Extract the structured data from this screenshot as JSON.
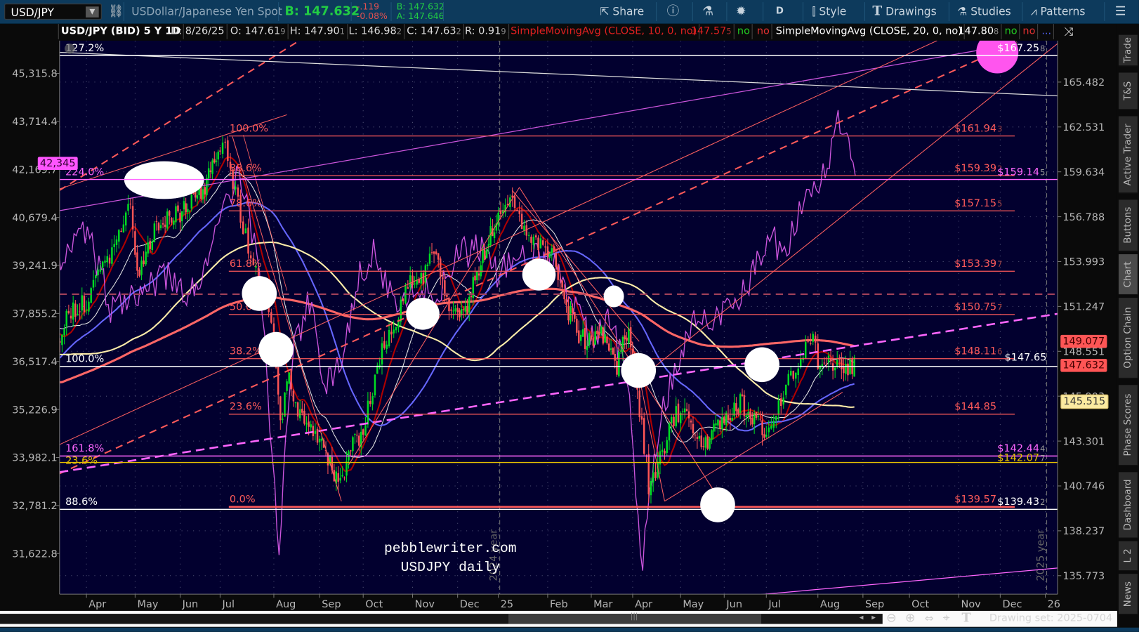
{
  "toolbar": {
    "symbol": "USD/JPY",
    "description": "USDollar/Japanese Yen Spot",
    "bid_big": "B: 147.632",
    "change": "-.119",
    "change_pct": "-0.08%",
    "bid": "B: 147.632",
    "ask": "A: 147.646",
    "share": "Share",
    "period": "D",
    "style": "Style",
    "drawings": "Drawings",
    "studies": "Studies",
    "patterns": "Patterns"
  },
  "header": {
    "title": "USD/JPY (BID) 5 Y 1D",
    "date": "D: 8/26/25",
    "open": "O: 147.61",
    "open_sub": "9",
    "high": "H: 147.90",
    "high_sub": "1",
    "low": "L: 146.98",
    "low_sub": "2",
    "close": "C: 147.63",
    "close_sub": "2",
    "range": "R: 0.91",
    "range_sub": "9",
    "sma10_label": "SimpleMovingAvg (CLOSE, 10, 0, no)",
    "sma10_value": "147.57",
    "sma10_sub": "5",
    "sma10_no1": "no",
    "sma10_no2": "no",
    "sma20_label": "SimpleMovingAvg (CLOSE, 20, 0, no)",
    "sma20_value": "147.80",
    "sma20_sub": "8",
    "sma20_no1": "no",
    "sma20_no2": "no",
    "more": "..."
  },
  "sidebar": [
    "Trade",
    "T&S",
    "Active Trader",
    "Buttons",
    "Chart",
    "Option Chain",
    "Phase Scores",
    "Dashboard",
    "L 2",
    "News"
  ],
  "sidebar_active": "Chart",
  "watermark": {
    "line1": "pebblewriter.com",
    "line2": "USDJPY daily"
  },
  "year_labels": [
    "2024 year",
    "2025 year"
  ],
  "bottom": {
    "drawing_set": "Drawing set: 2025-0704"
  },
  "badges": {
    "left_nikkei": "42,345",
    "sma200": "149.077",
    "last": "147.632",
    "sma100": "145.515"
  },
  "colors": {
    "bg": "#02002f",
    "up": "#00dd22",
    "down": "#ff5555",
    "fib": "#ff5a5a",
    "magenta": "#ff66ff",
    "yellow": "#ffe36e",
    "accent_green": "#22cc44"
  },
  "chart_data": {
    "type": "candlestick",
    "symbol": "USD/JPY",
    "right_axis_ticks": [
      "165.482",
      "162.531",
      "159.634",
      "156.788",
      "153.993",
      "151.247",
      "148.551",
      "145.903",
      "143.301",
      "140.746",
      "138.237",
      "135.773"
    ],
    "left_axis_ticks": [
      "45,315.8",
      "43,714.4",
      "42,169.7",
      "40,679.4",
      "39,241.9",
      "37,855.2",
      "36,517.4",
      "35,226.9",
      "33,982.1",
      "32,781.2",
      "31,622.8"
    ],
    "x_ticks": [
      "Apr",
      "May",
      "Jun",
      "Jul",
      "Aug",
      "Sep",
      "Oct",
      "Nov",
      "Dec",
      "25",
      "Feb",
      "Mar",
      "Apr",
      "May",
      "Jun",
      "Jul",
      "Aug",
      "Sep",
      "Oct",
      "Nov",
      "Dec",
      "26"
    ],
    "price_keypoints_months_since_apr2024": [
      [
        -10,
        140
      ],
      [
        -8,
        144
      ],
      [
        -6,
        149
      ],
      [
        -4.5,
        151.5
      ],
      [
        -3.5,
        147
      ],
      [
        -3,
        142
      ],
      [
        -2.5,
        146
      ],
      [
        -2,
        148
      ],
      [
        -1.5,
        150
      ],
      [
        -1,
        150.5
      ],
      [
        -0.6,
        148.5
      ],
      [
        -0.4,
        151
      ],
      [
        0,
        151.5
      ],
      [
        0.5,
        154.5
      ],
      [
        0.9,
        157.5
      ],
      [
        1.05,
        153
      ],
      [
        1.5,
        156.5
      ],
      [
        2,
        157
      ],
      [
        2.6,
        158.5
      ],
      [
        3.05,
        161.7
      ],
      [
        3.3,
        158
      ],
      [
        3.6,
        154
      ],
      [
        3.95,
        150
      ],
      [
        4.15,
        144
      ],
      [
        4.3,
        147.5
      ],
      [
        4.5,
        145
      ],
      [
        4.9,
        144
      ],
      [
        5.5,
        140.5
      ],
      [
        5.65,
        143
      ],
      [
        6,
        143.8
      ],
      [
        6.3,
        148
      ],
      [
        6.6,
        150
      ],
      [
        6.9,
        152.5
      ],
      [
        7.2,
        153
      ],
      [
        7.5,
        154.5
      ],
      [
        7.9,
        150.5
      ],
      [
        8.2,
        151
      ],
      [
        8.5,
        153.5
      ],
      [
        9,
        157
      ],
      [
        9.3,
        158
      ],
      [
        9.5,
        156
      ],
      [
        9.8,
        155
      ],
      [
        10.1,
        154.5
      ],
      [
        10.4,
        151.5
      ],
      [
        10.7,
        149.5
      ],
      [
        11,
        149
      ],
      [
        11.3,
        149.5
      ],
      [
        11.6,
        147.5
      ],
      [
        11.9,
        150
      ],
      [
        12.1,
        146
      ],
      [
        12.35,
        140.5
      ],
      [
        12.6,
        142.5
      ],
      [
        12.9,
        145
      ],
      [
        13.2,
        144.5
      ],
      [
        13.5,
        142.8
      ],
      [
        13.8,
        144
      ],
      [
        14.1,
        144.5
      ],
      [
        14.4,
        145.5
      ],
      [
        14.7,
        144.5
      ],
      [
        15,
        144
      ],
      [
        15.3,
        146
      ],
      [
        15.6,
        148
      ],
      [
        15.9,
        149.8
      ],
      [
        16,
        147.5
      ],
      [
        16.3,
        147.8
      ],
      [
        16.6,
        147.4
      ],
      [
        16.85,
        147.63
      ]
    ],
    "nikkei_keypoints": [
      [
        -0.6,
        39500
      ],
      [
        0,
        40300
      ],
      [
        0.5,
        38000
      ],
      [
        0.9,
        38500
      ],
      [
        1.2,
        38500
      ],
      [
        1.7,
        38900
      ],
      [
        2.2,
        38300
      ],
      [
        2.8,
        39600
      ],
      [
        3.35,
        42200
      ],
      [
        3.7,
        39500
      ],
      [
        4.1,
        31500
      ],
      [
        4.4,
        36700
      ],
      [
        4.8,
        38300
      ],
      [
        5.1,
        36000
      ],
      [
        5.4,
        36200
      ],
      [
        5.9,
        38900
      ],
      [
        6.2,
        39600
      ],
      [
        6.6,
        38300
      ],
      [
        7,
        38600
      ],
      [
        7.5,
        38300
      ],
      [
        8,
        39500
      ],
      [
        8.5,
        39800
      ],
      [
        9,
        39000
      ],
      [
        9.5,
        39500
      ],
      [
        10,
        39500
      ],
      [
        10.5,
        38500
      ],
      [
        11,
        37200
      ],
      [
        11.5,
        37700
      ],
      [
        11.9,
        35700
      ],
      [
        12.2,
        31200
      ],
      [
        12.5,
        34500
      ],
      [
        12.9,
        36500
      ],
      [
        13.3,
        37800
      ],
      [
        13.7,
        37500
      ],
      [
        14,
        38000
      ],
      [
        14.5,
        38500
      ],
      [
        15,
        40000
      ],
      [
        15.4,
        39800
      ],
      [
        15.7,
        41000
      ],
      [
        16.1,
        41800
      ],
      [
        16.4,
        43500
      ],
      [
        16.55,
        43700
      ],
      [
        16.7,
        42700
      ],
      [
        16.85,
        42345
      ]
    ],
    "moving_averages": [
      {
        "period": 10,
        "color": "#b00000"
      },
      {
        "period": 20,
        "color": "#e8e8e8"
      },
      {
        "period": 50,
        "color": "#6666ff"
      },
      {
        "period": 100,
        "color": "#ffeeaa"
      },
      {
        "period": 200,
        "color": "#ff6666"
      }
    ],
    "fib_levels": [
      {
        "pct": "100.0%",
        "price": 161.943,
        "label": "$161.94",
        "sub": "3"
      },
      {
        "pct": "88.6%",
        "price": 159.392,
        "label": "$159.39",
        "sub": "2"
      },
      {
        "pct": "78.6%",
        "price": 157.155,
        "label": "$157.15",
        "sub": "5"
      },
      {
        "pct": "61.8%",
        "price": 153.397,
        "label": "$153.39",
        "sub": "7"
      },
      {
        "pct": "50.0%",
        "price": 150.757,
        "label": "$150.75",
        "sub": "7"
      },
      {
        "pct": "38.2%",
        "price": 148.116,
        "label": "$148.11",
        "sub": "6"
      },
      {
        "pct": "23.6%",
        "price": 144.85,
        "label": "$144.85",
        "sub": ""
      },
      {
        "pct": "0.0%",
        "price": 139.57,
        "label": "$139.57",
        "sub": ""
      }
    ],
    "full_levels": [
      {
        "pct": "127.2%",
        "price": 167.258,
        "label": "$167.25",
        "sub": "8",
        "color": "#ffffff"
      },
      {
        "pct": "224.0%",
        "price": 159.145,
        "label": "$159.14",
        "sub": "5",
        "color": "#ff66ff"
      },
      {
        "pct": "100.0%",
        "price": 147.65,
        "label": "$147.65",
        "sub": "",
        "color": "#ffffff"
      },
      {
        "pct": "161.8%",
        "price": 142.444,
        "label": "$142.44",
        "sub": "4",
        "color": "#ff66ff"
      },
      {
        "pct": "23.6%",
        "price": 142.077,
        "label": "$142.07",
        "sub": "7",
        "color": "#e6c200"
      },
      {
        "pct": "88.6%",
        "price": 139.432,
        "label": "$139.43",
        "sub": "2",
        "color": "#ffffff"
      }
    ]
  }
}
